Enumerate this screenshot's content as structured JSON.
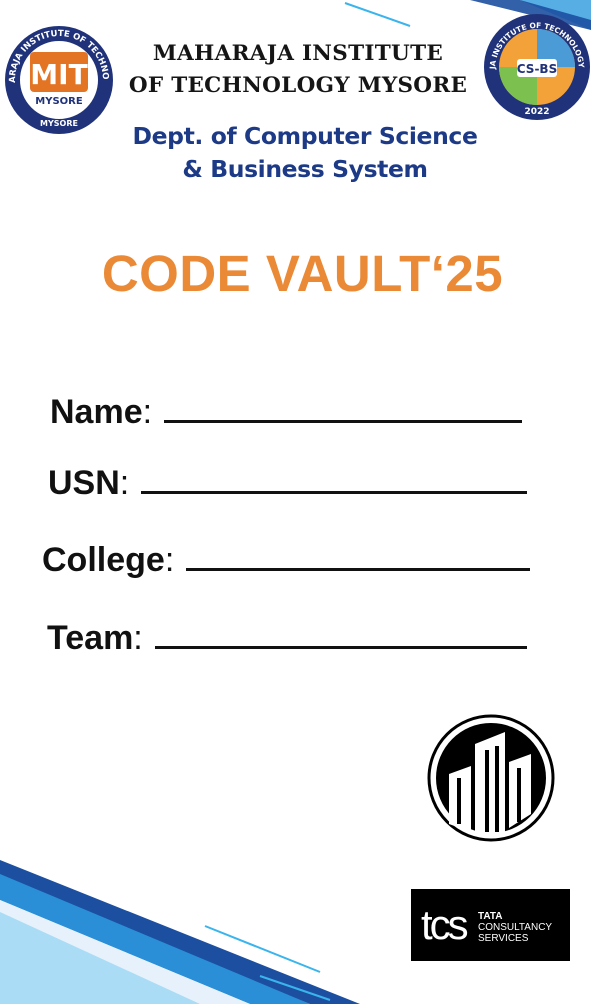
{
  "header": {
    "institute_line1": "MAHARAJA INSTITUTE",
    "institute_line2": "OF TECHNOLOGY MYSORE",
    "dept_line1": "Dept. of Computer Science",
    "dept_line2": "& Business System"
  },
  "left_logo": {
    "ring_text": "MAHARAJA INSTITUTE OF TECHNOLOGY",
    "ring_bottom": "MYSORE",
    "mark": "MIT",
    "city": "MYSORE"
  },
  "right_logo": {
    "ring_text": "MAHARAJA INSTITUTE OF TECHNOLOGY MYSORE",
    "mark": "CS-BS",
    "year": "2022"
  },
  "event": {
    "title": "CODE VAULT‘25"
  },
  "form": {
    "fields": [
      {
        "label": "Name",
        "colon": ":"
      },
      {
        "label": "USN",
        "colon": ":"
      },
      {
        "label": "College",
        "colon": ":"
      },
      {
        "label": "Team",
        "colon": ":"
      }
    ]
  },
  "sponsor": {
    "mark": "tcs",
    "line1": "TATA",
    "line2": "CONSULTANCY",
    "line3": "SERVICES"
  },
  "colors": {
    "title_orange": "#ea8a36",
    "dept_blue": "#1c3a86",
    "logo_blue": "#20337a",
    "logo_orange": "#e27424",
    "stripe_blue": "#2a8fd6",
    "stripe_light": "#3ab4ec"
  },
  "icons": {
    "building_logo": "city-buildings-icon"
  }
}
